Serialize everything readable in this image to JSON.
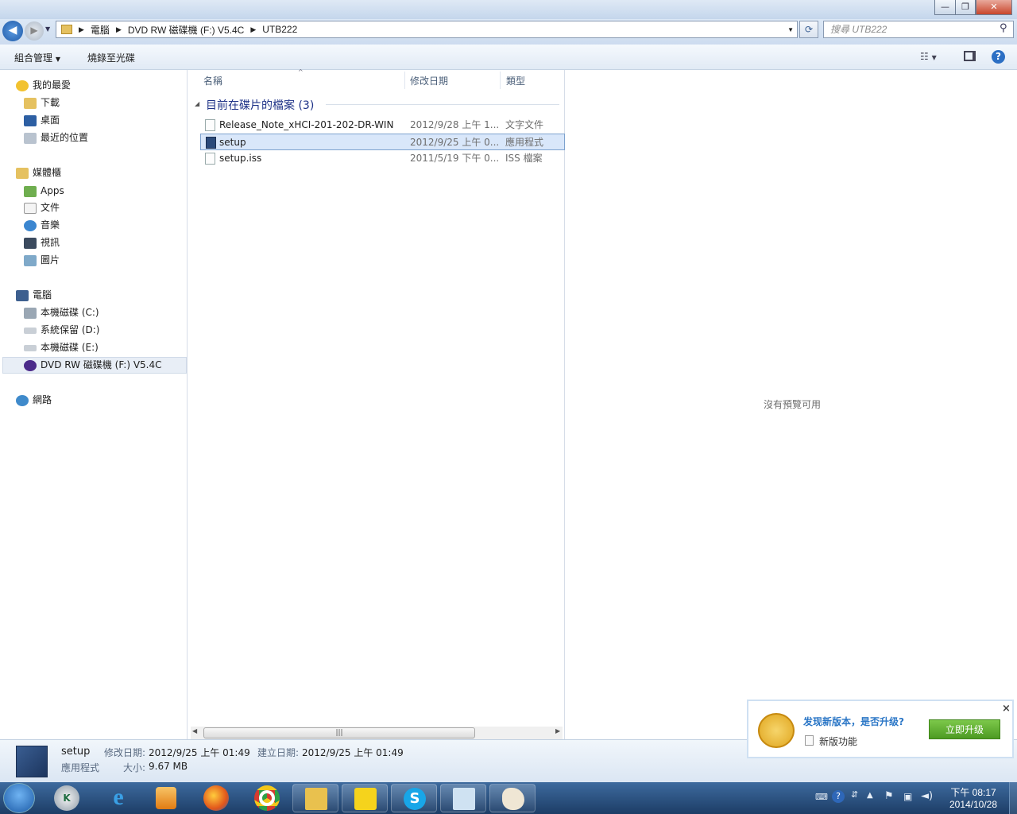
{
  "window": {
    "minimize_glyph": "—",
    "maximize_glyph": "❐",
    "close_glyph": "✕"
  },
  "address": {
    "segments": [
      "電腦",
      "DVD RW 磁碟機 (F:) V5.4C",
      "UTB222"
    ],
    "search_placeholder": "搜尋 UTB222"
  },
  "toolbar": {
    "organize": "組合管理",
    "burn": "燒錄至光碟"
  },
  "navigation": {
    "favorites": {
      "label": "我的最愛",
      "items": [
        "下載",
        "桌面",
        "最近的位置"
      ]
    },
    "libraries": {
      "label": "媒體櫃",
      "items": [
        "Apps",
        "文件",
        "音樂",
        "視訊",
        "圖片"
      ]
    },
    "computer": {
      "label": "電腦",
      "items": [
        "本機磁碟 (C:)",
        "系統保留 (D:)",
        "本機磁碟 (E:)",
        "DVD RW 磁碟機 (F:) V5.4C"
      ]
    },
    "network": {
      "label": "網路"
    }
  },
  "columns": {
    "name": "名稱",
    "date": "修改日期",
    "type": "類型"
  },
  "group": {
    "title": "目前在碟片的檔案 (3)"
  },
  "files": [
    {
      "name": "Release_Note_xHCI-201-202-DR-WIN",
      "date": "2012/9/28 上午 1...",
      "type": "文字文件",
      "icon": "text-file-icon"
    },
    {
      "name": "setup",
      "date": "2012/9/25 上午 0...",
      "type": "應用程式",
      "icon": "setup-app-icon"
    },
    {
      "name": "setup.iss",
      "date": "2011/5/19 下午 0...",
      "type": "ISS 檔案",
      "icon": "file-icon"
    }
  ],
  "preview": {
    "message": "沒有預覽可用"
  },
  "details": {
    "name": "setup",
    "kind": "應用程式",
    "modified_label": "修改日期:",
    "modified_value": "2012/9/25 上午 01:49",
    "created_label": "建立日期:",
    "created_value": "2012/9/25 上午 01:49",
    "size_label": "大小:",
    "size_value": "9.67 MB"
  },
  "notification": {
    "title": "发现新版本，是否升级?",
    "feature": "新版功能",
    "button": "立即升级",
    "close": "×"
  },
  "taskbar": {
    "time": "下午 08:17",
    "date": "2014/10/28",
    "apps": [
      "start-orb-icon",
      "kaspersky-icon",
      "internet-explorer-icon",
      "media-player-icon",
      "firefox-icon",
      "chrome-icon",
      "explorer-icon",
      "yellow-app-icon",
      "skype-icon",
      "remote-desktop-icon",
      "paint-icon"
    ]
  },
  "colors": {
    "selection": "#d9e7fa",
    "group_title": "#1e3287",
    "taskbar": "#1d3d66",
    "notify_title": "#2a76c6",
    "notify_button": "#5aaa2b"
  }
}
